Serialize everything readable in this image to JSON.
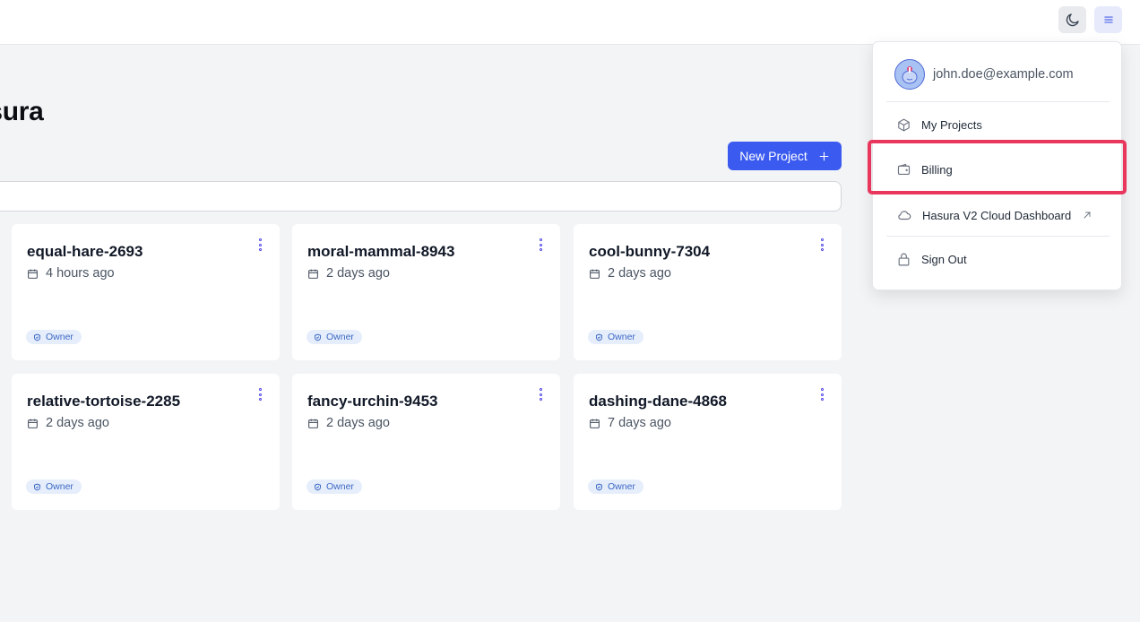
{
  "header": {
    "theme_icon": "moon-icon",
    "menu_icon": "hamburger-menu-icon"
  },
  "workspace": {
    "title": "asura",
    "new_project_label": "New Project",
    "search_placeholder": ""
  },
  "projects": [
    {
      "name": "equal-hare-2693",
      "time": "4 hours ago",
      "role": "Owner"
    },
    {
      "name": "moral-mammal-8943",
      "time": "2 days ago",
      "role": "Owner"
    },
    {
      "name": "cool-bunny-7304",
      "time": "2 days ago",
      "role": "Owner"
    },
    {
      "name": "relative-tortoise-2285",
      "time": "2 days ago",
      "role": "Owner"
    },
    {
      "name": "fancy-urchin-9453",
      "time": "2 days ago",
      "role": "Owner"
    },
    {
      "name": "dashing-dane-4868",
      "time": "7 days ago",
      "role": "Owner"
    }
  ],
  "user_menu": {
    "email": "john.doe@example.com",
    "items": [
      {
        "label": "My Projects",
        "icon": "cube-icon"
      },
      {
        "label": "Billing",
        "icon": "wallet-icon"
      },
      {
        "label": "Hasura V2 Cloud Dashboard",
        "icon": "cloud-icon",
        "external_icon": "external-link-arrow-icon"
      },
      {
        "label": "Sign Out",
        "icon": "lock-icon"
      }
    ]
  },
  "colors": {
    "accent": "#3b5bf0",
    "highlight": "#e8365d",
    "badge_bg": "#e6eefc",
    "badge_text": "#3b68c4"
  }
}
